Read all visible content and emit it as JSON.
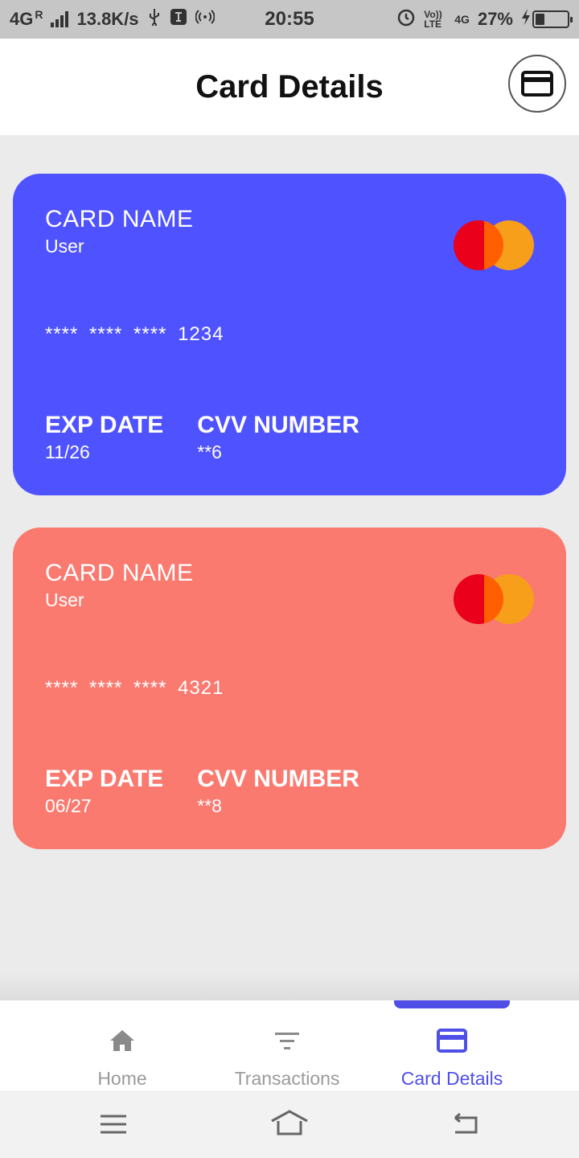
{
  "status_bar": {
    "network": "4G",
    "roaming": "R",
    "speed": "13.8K/s",
    "time": "20:55",
    "volte": "Vo)) LTE",
    "net2": "4G",
    "battery": "27%"
  },
  "header": {
    "title": "Card Details"
  },
  "cards": [
    {
      "name_label": "CARD NAME",
      "holder": "User",
      "number": "**** **** **** 1234",
      "exp_label": "EXP DATE",
      "exp_value": "11/26",
      "cvv_label": "CVV NUMBER",
      "cvv_value": "**6",
      "color": "#4f52ff"
    },
    {
      "name_label": "CARD NAME",
      "holder": "User",
      "number": "**** **** **** 4321",
      "exp_label": "EXP DATE",
      "exp_value": "06/27",
      "cvv_label": "CVV NUMBER",
      "cvv_value": "**8",
      "color": "#fa7a70"
    }
  ],
  "bottom_nav": {
    "items": [
      {
        "label": "Home",
        "icon": "home-icon"
      },
      {
        "label": "Transactions",
        "icon": "filter-icon"
      },
      {
        "label": "Card Details",
        "icon": "credit-card-icon"
      }
    ],
    "active_color": "#4f4fe8"
  }
}
